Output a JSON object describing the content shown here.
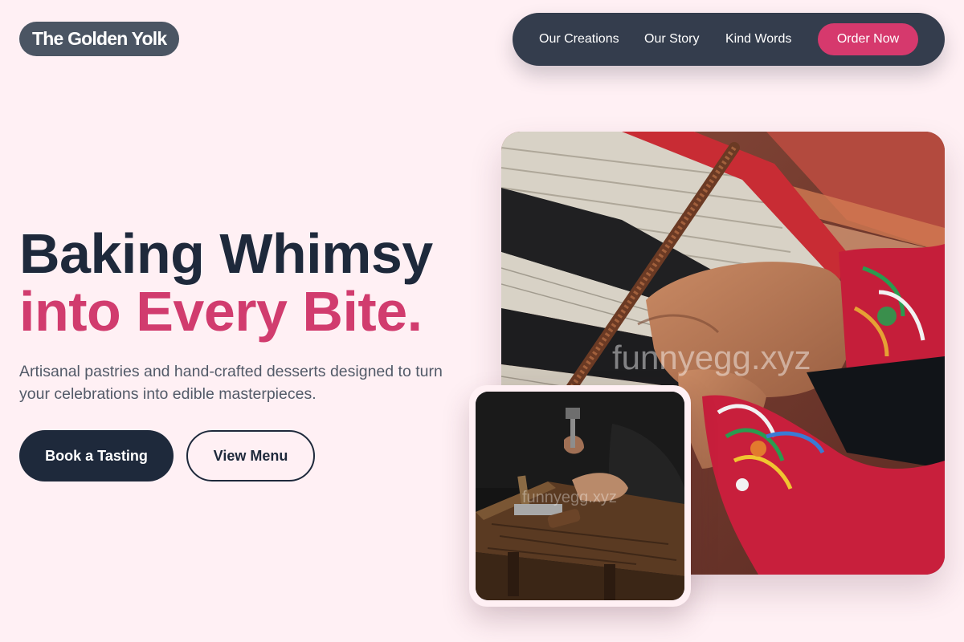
{
  "brand": {
    "name": "The Golden Yolk"
  },
  "nav": {
    "links": [
      "Our Creations",
      "Our Story",
      "Kind Words"
    ],
    "cta": "Order Now"
  },
  "hero": {
    "headline_line1": "Baking Whimsy",
    "headline_line2": "into Every Bite.",
    "subtext": "Artisanal pastries and hand-crafted desserts designed to turn your celebrations into edible masterpieces.",
    "primary_button": "Book a Tasting",
    "secondary_button": "View Menu"
  },
  "images": {
    "main_watermark": "funnyegg.xyz",
    "small_watermark": "funnyegg.xyz"
  },
  "colors": {
    "background": "#fff0f4",
    "dark_navy": "#1e293b",
    "accent_pink": "#d6396d",
    "nav_bg": "#343d4d",
    "logo_bg": "#4b5563"
  }
}
